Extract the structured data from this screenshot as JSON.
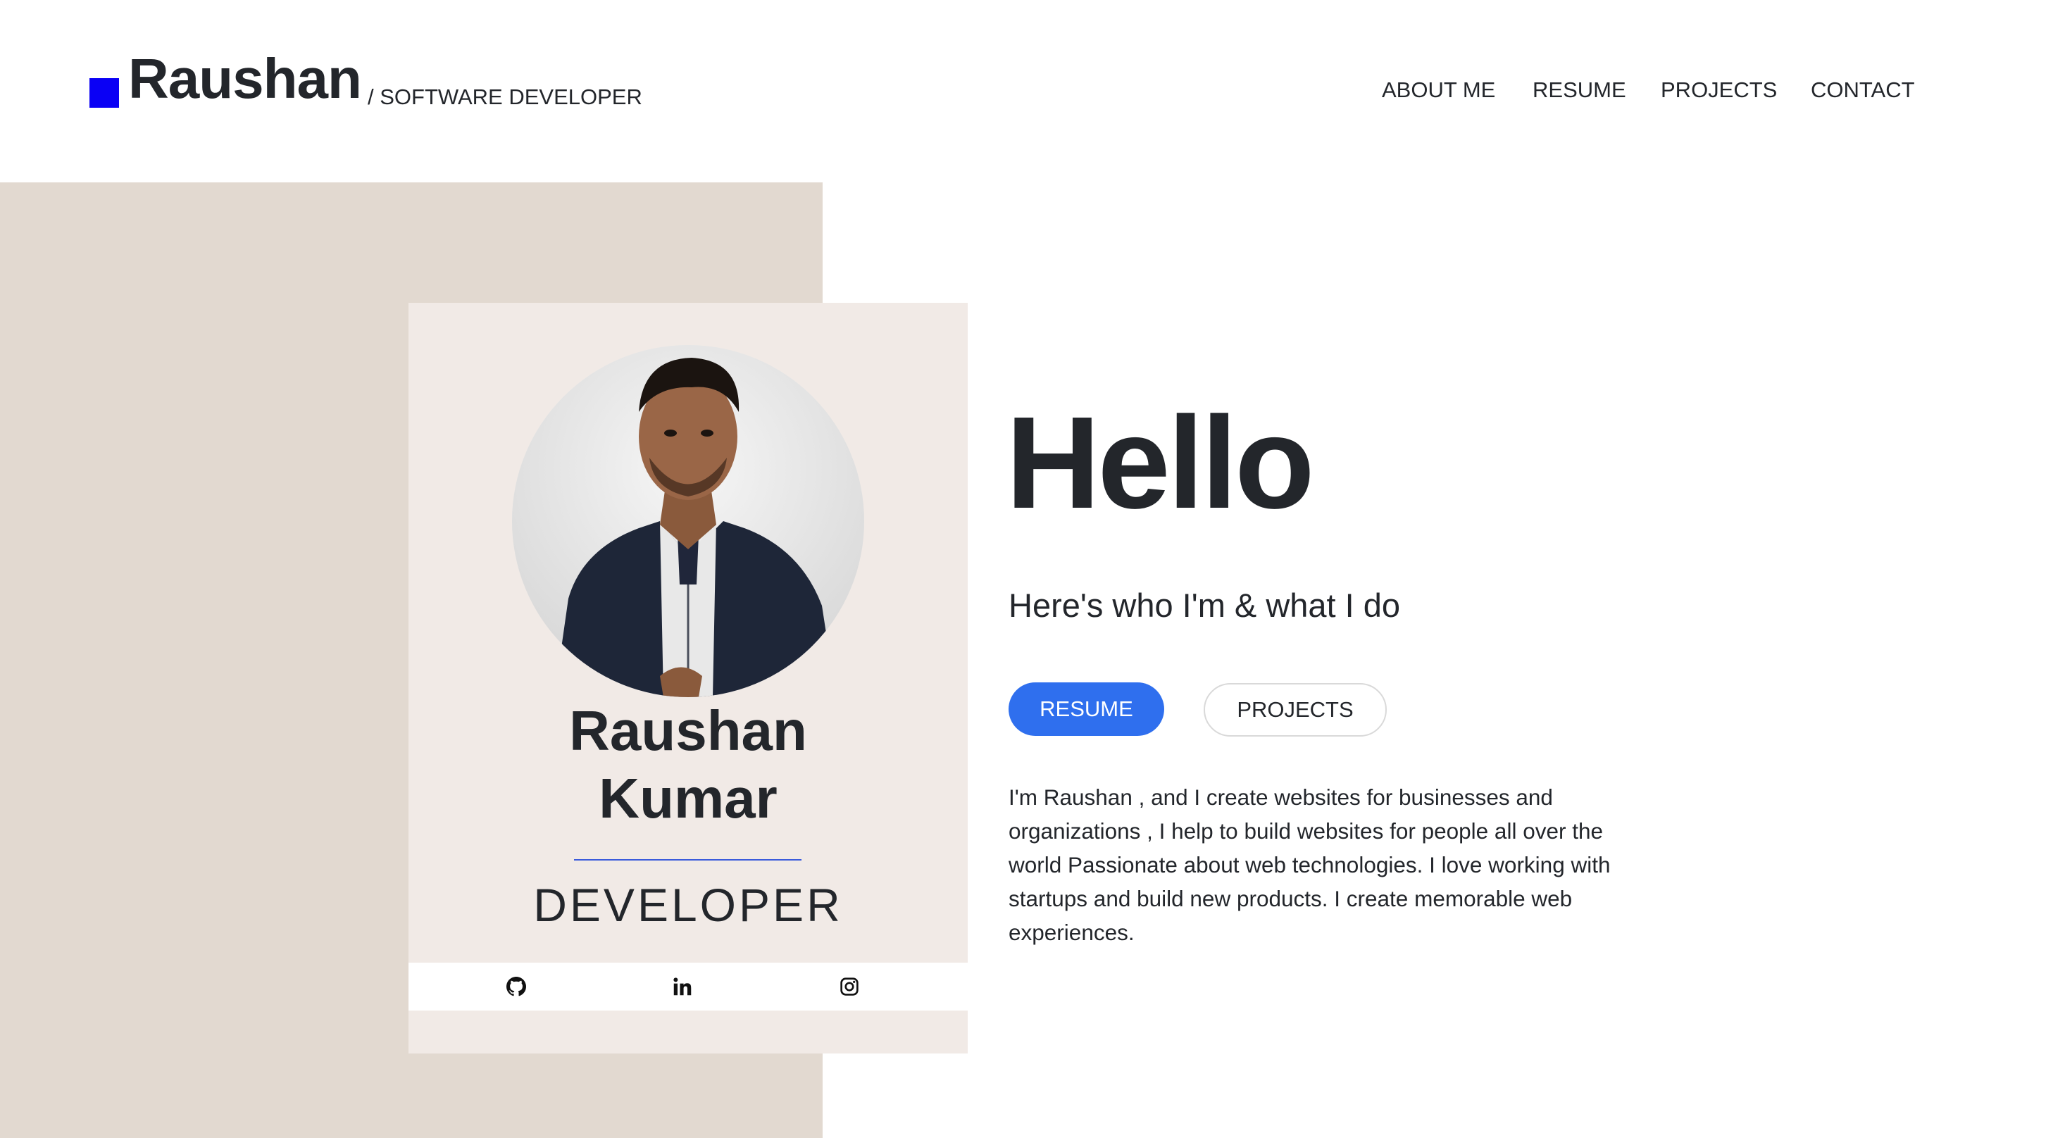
{
  "header": {
    "brand_name": "Raushan",
    "brand_subtitle": "/ SOFTWARE DEVELOPER",
    "brand_color": "#0a00f5",
    "nav": [
      {
        "label": "ABOUT ME"
      },
      {
        "label": "RESUME"
      },
      {
        "label": "PROJECTS"
      },
      {
        "label": "CONTACT"
      }
    ]
  },
  "profile_card": {
    "photo": "profile-photo",
    "first_name": "Raushan",
    "last_name": "Kumar",
    "role": "DEVELOPER",
    "socials": [
      {
        "icon": "github-icon"
      },
      {
        "icon": "linkedin-icon"
      },
      {
        "icon": "instagram-icon"
      }
    ]
  },
  "hero": {
    "greeting": "Hello",
    "tagline": "Here's who I'm & what I do",
    "primary_button": "RESUME",
    "secondary_button": "PROJECTS",
    "bio": "I'm Raushan , and I create websites for businesses and organizations , I help to build websites for people all over the world Passionate about web technologies. I love working with startups and build new products. I create memorable web experiences."
  },
  "colors": {
    "accent": "#2f6fee",
    "panel_bg": "#e2d9d0",
    "card_bg": "#f1eae6",
    "text": "#23262b"
  }
}
